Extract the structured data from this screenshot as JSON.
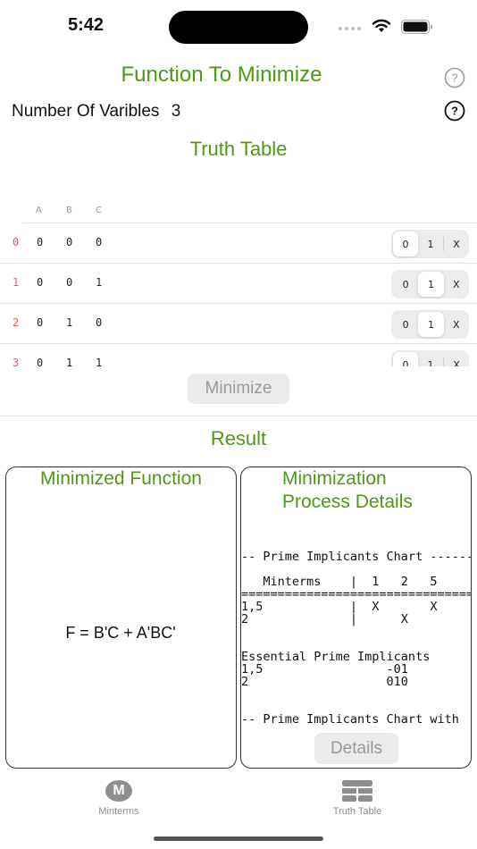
{
  "status_bar": {
    "time": "5:42"
  },
  "header": {
    "title": "Function To Minimize",
    "num_variables_label": "Number Of Varibles",
    "num_variables_value": "3",
    "help_icon": "question-circle-icon"
  },
  "truth_table": {
    "title": "Truth Table",
    "columns": [
      "A",
      "B",
      "C"
    ],
    "options": [
      "0",
      "1",
      "X"
    ],
    "rows": [
      {
        "index": "0",
        "values": [
          "0",
          "0",
          "0"
        ],
        "output": "0"
      },
      {
        "index": "1",
        "values": [
          "0",
          "0",
          "1"
        ],
        "output": "1"
      },
      {
        "index": "2",
        "values": [
          "0",
          "1",
          "0"
        ],
        "output": "1"
      },
      {
        "index": "3",
        "values": [
          "0",
          "1",
          "1"
        ],
        "output": "0"
      }
    ]
  },
  "minimize_button": "Minimize",
  "result": {
    "title": "Result",
    "minimized_function_title": "Minimized Function",
    "minimized_function": "F = B'C + A'BC'",
    "process_title_line1": "Minimization",
    "process_title_line2": "Process Details",
    "process_text": "-- Prime Implicants Chart ------\n\n   Minterms    |  1   2   5\n=================================\n1,5            |  X       X\n2              |      X\n\n\nEssential Prime Implicants\n1,5                 -01\n2                   010\n\n\n-- Prime Implicants Chart with",
    "details_button": "Details"
  },
  "tabbar": {
    "tabs": [
      {
        "label": "Minterms",
        "icon": "m-circle-icon",
        "glyph": "M"
      },
      {
        "label": "Truth Table",
        "icon": "table-icon"
      }
    ]
  },
  "colors": {
    "accent_green": "#4c9a12",
    "row_index_red": "#f25555",
    "disabled_gray": "#9a9a9a"
  }
}
